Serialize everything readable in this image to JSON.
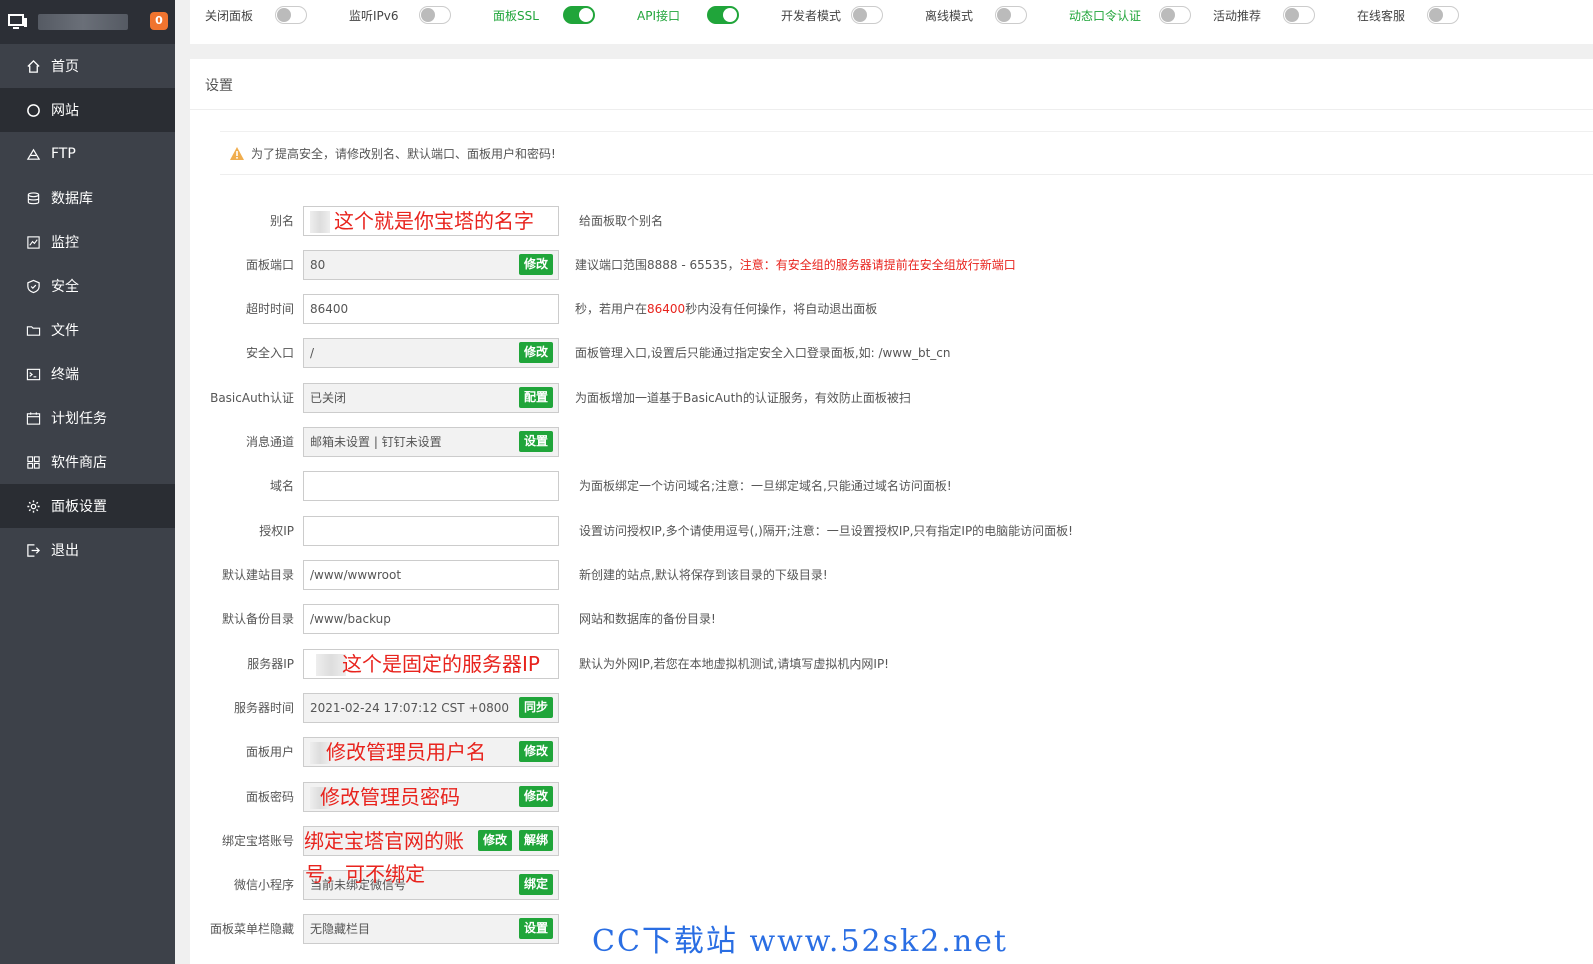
{
  "sidebar": {
    "badge": "0",
    "items": [
      {
        "label": "首页",
        "icon": "home-icon"
      },
      {
        "label": "网站",
        "icon": "globe-icon"
      },
      {
        "label": "FTP",
        "icon": "ftp-icon"
      },
      {
        "label": "数据库",
        "icon": "database-icon"
      },
      {
        "label": "监控",
        "icon": "monitor-chart-icon"
      },
      {
        "label": "安全",
        "icon": "shield-icon"
      },
      {
        "label": "文件",
        "icon": "folder-icon"
      },
      {
        "label": "终端",
        "icon": "terminal-icon"
      },
      {
        "label": "计划任务",
        "icon": "calendar-icon"
      },
      {
        "label": "软件商店",
        "icon": "grid-icon"
      },
      {
        "label": "面板设置",
        "icon": "gear-icon"
      },
      {
        "label": "退出",
        "icon": "logout-icon"
      }
    ]
  },
  "toggles": [
    {
      "label": "关闭面板",
      "on": false,
      "green": false
    },
    {
      "label": "监听IPv6",
      "on": false,
      "green": false
    },
    {
      "label": "面板SSL",
      "on": true,
      "green": true
    },
    {
      "label": "API接口",
      "on": true,
      "green": true
    },
    {
      "label": "开发者模式",
      "on": false,
      "green": false
    },
    {
      "label": "离线模式",
      "on": false,
      "green": false
    },
    {
      "label": "动态口令认证",
      "on": false,
      "green": true
    },
    {
      "label": "活动推荐",
      "on": false,
      "green": false
    },
    {
      "label": "在线客服",
      "on": false,
      "green": false
    }
  ],
  "panel": {
    "title": "设置",
    "warning": "为了提高安全，请修改别名、默认端口、面板用户和密码!"
  },
  "rows": {
    "alias": {
      "label": "别名",
      "overlay": "这个就是你宝塔的名字",
      "desc": "给面板取个别名"
    },
    "port": {
      "label": "面板端口",
      "value": "80",
      "button": "修改",
      "desc": "建议端口范围8888 - 65535，",
      "desc_red": "注意：有安全组的服务器请提前在安全组放行新端口"
    },
    "timeout": {
      "label": "超时时间",
      "value": "86400",
      "desc_a": "秒，若用户在",
      "desc_red": "86400",
      "desc_b": "秒内没有任何操作，将自动退出面板"
    },
    "entry": {
      "label": "安全入口",
      "value": "/",
      "button": "修改",
      "desc": "面板管理入口,设置后只能通过指定安全入口登录面板,如: /www_bt_cn"
    },
    "basicauth": {
      "label": "BasicAuth认证",
      "value": "已关闭",
      "button": "配置",
      "desc": "为面板增加一道基于BasicAuth的认证服务，有效防止面板被扫"
    },
    "message": {
      "label": "消息通道",
      "value": "邮箱未设置 | 钉钉未设置",
      "button": "设置"
    },
    "domain": {
      "label": "域名",
      "value": "",
      "desc": "为面板绑定一个访问域名;注意：一旦绑定域名,只能通过域名访问面板!"
    },
    "authip": {
      "label": "授权IP",
      "value": "",
      "desc": "设置访问授权IP,多个请使用逗号(,)隔开;注意：一旦设置授权IP,只有指定IP的电脑能访问面板!"
    },
    "sitedir": {
      "label": "默认建站目录",
      "value": "/www/wwwroot",
      "desc": "新创建的站点,默认将保存到该目录的下级目录!"
    },
    "backupdir": {
      "label": "默认备份目录",
      "value": "/www/backup",
      "desc": "网站和数据库的备份目录!"
    },
    "serverip": {
      "label": "服务器IP",
      "overlay": "这个是固定的服务器IP",
      "desc": "默认为外网IP,若您在本地虚拟机测试,请填写虚拟机内网IP!"
    },
    "servertime": {
      "label": "服务器时间",
      "value": "2021-02-24 17:07:12 CST +0800",
      "button": "同步"
    },
    "user": {
      "label": "面板用户",
      "overlay": "修改管理员用户名",
      "button": "修改"
    },
    "password": {
      "label": "面板密码",
      "overlay": "修改管理员密码",
      "button": "修改"
    },
    "bind": {
      "label": "绑定宝塔账号",
      "overlay": "绑定宝塔官网的账",
      "overlay2": "号，可不绑定",
      "button": "修改",
      "button2": "解绑"
    },
    "wechat": {
      "label": "微信小程序",
      "value": "当前未绑定微信号",
      "button": "绑定"
    },
    "menuhide": {
      "label": "面板菜单栏隐藏",
      "value": "无隐藏栏目",
      "button": "设置"
    }
  },
  "watermark": "CC下载站 www.52sk2.net"
}
